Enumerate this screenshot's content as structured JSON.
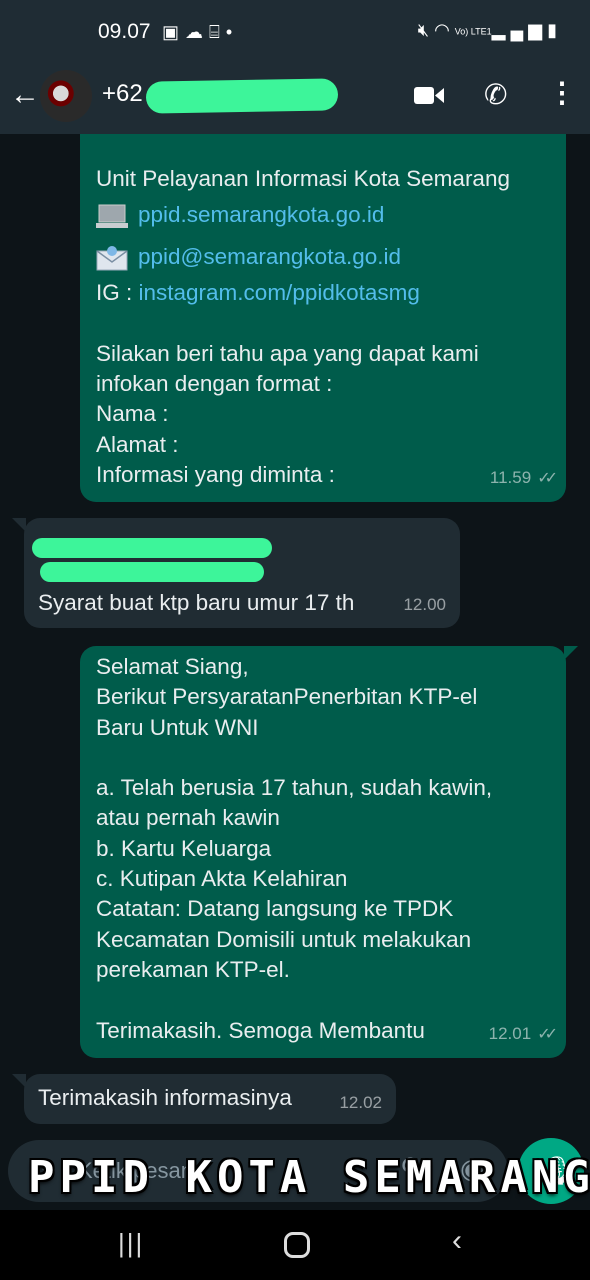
{
  "status_bar": {
    "time": "09.07",
    "left_icons": [
      "gallery-icon",
      "cloud-icon",
      "gift-icon",
      "dot-icon"
    ],
    "right_icons": [
      "mute-icon",
      "wifi-icon",
      "lte-icon",
      "signal-icon",
      "battery-icon"
    ],
    "lte_label": "Vo) LTE1"
  },
  "header": {
    "contact_name": "+62",
    "icons": [
      "back-arrow-icon",
      "avatar",
      "video-call-icon",
      "voice-call-icon",
      "more-options-icon"
    ]
  },
  "messages": [
    {
      "direction": "outgoing",
      "time": "11.59",
      "ticks": "✓✓",
      "lines": [
        "Unit Pelayanan Informasi Kota Semarang",
        "ppid.semarangkota.go.id",
        "ppid@semarangkota.go.id",
        "IG : ",
        "instagram.com/ppidkotasmg",
        "Silakan beri tahu apa yang dapat kami",
        "infokan dengan format :",
        "Nama :",
        "Alamat :",
        "Informasi yang diminta :"
      ]
    },
    {
      "direction": "incoming",
      "time": "12.00",
      "text": "Syarat buat ktp baru umur 17 th"
    },
    {
      "direction": "outgoing",
      "time": "12.01",
      "ticks": "✓✓",
      "lines": [
        "Selamat Siang,",
        "Berikut PersyaratanPenerbitan KTP-el",
        "Baru Untuk WNI",
        "a. Telah berusia 17 tahun, sudah kawin,",
        "atau pernah kawin",
        "b. Kartu Keluarga",
        "c. Kutipan Akta Kelahiran",
        "Catatan: Datang langsung ke TPDK",
        "Kecamatan Domisili untuk melakukan",
        "perekaman KTP-el.",
        "Terimakasih. Semoga Membantu"
      ]
    },
    {
      "direction": "incoming",
      "time": "12.02",
      "text": "Terimakasih informasinya"
    }
  ],
  "input": {
    "placeholder": "Ketik pesan"
  },
  "overlay": {
    "caption": "PPID KOTA SEMARANG"
  },
  "colors": {
    "outgoing_bubble": "#005c4b",
    "incoming_bubble": "#202c33",
    "link": "#53bdeb",
    "accent": "#00a884",
    "redaction": "#3df59a"
  }
}
